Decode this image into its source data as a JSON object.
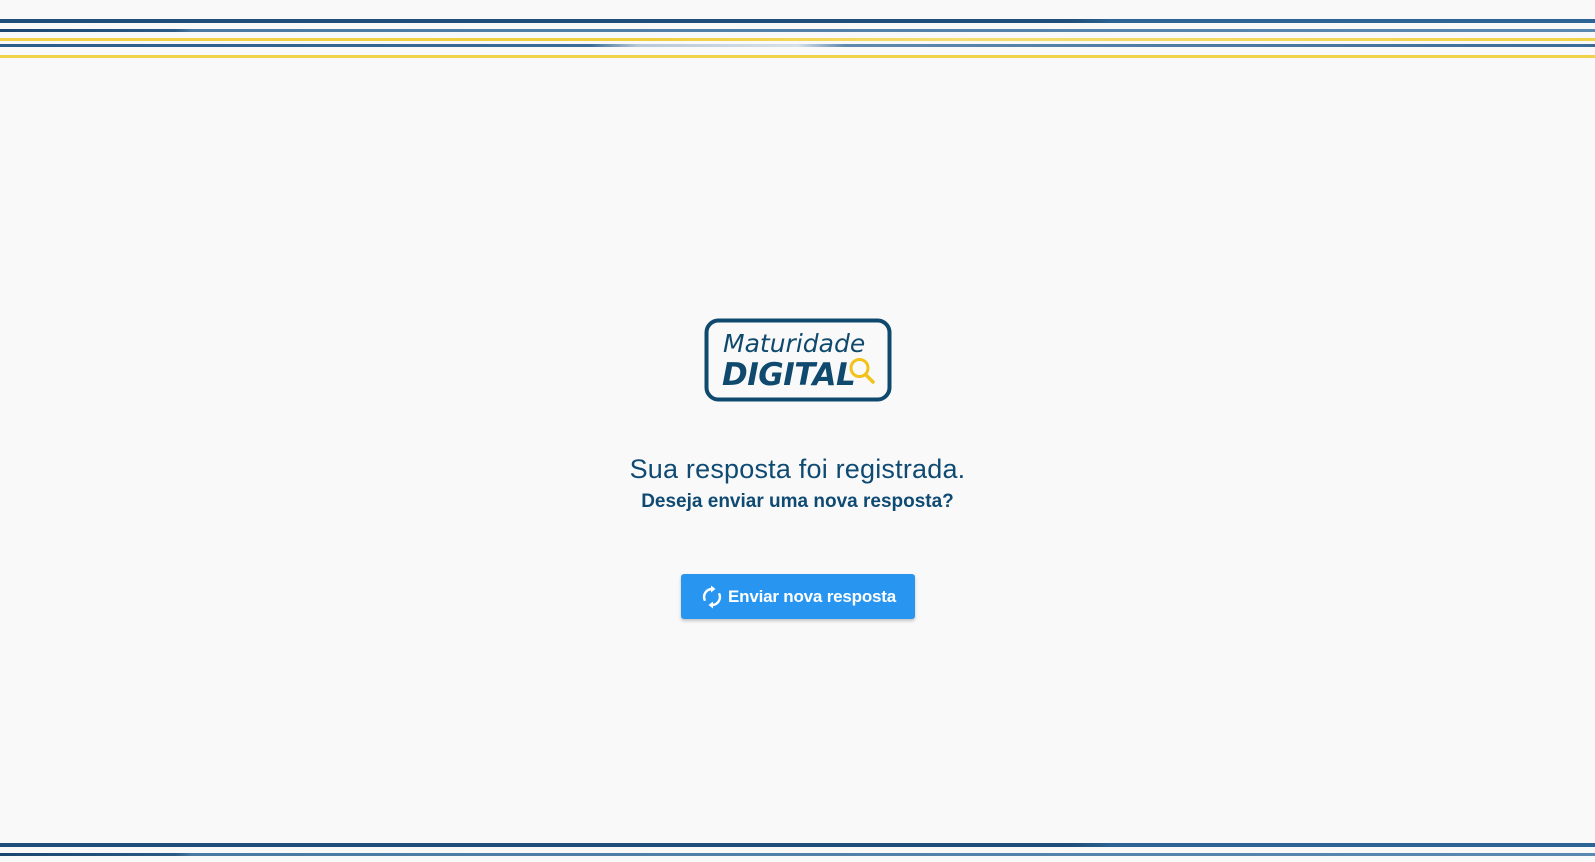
{
  "logo": {
    "line1": "Maturidade",
    "line2": "DIGITAL",
    "icon": "magnifier-icon"
  },
  "message": {
    "title": "Sua resposta foi registrada.",
    "subtitle": "Deseja enviar uma nova resposta?"
  },
  "action": {
    "label": "Enviar nova resposta",
    "icon": "refresh-icon"
  },
  "colors": {
    "primary_text": "#0f4a73",
    "button": "#2896f0",
    "stripe_blue": "#1f4e7a",
    "stripe_yellow": "#f0d34b",
    "background": "#f9f9f9"
  }
}
